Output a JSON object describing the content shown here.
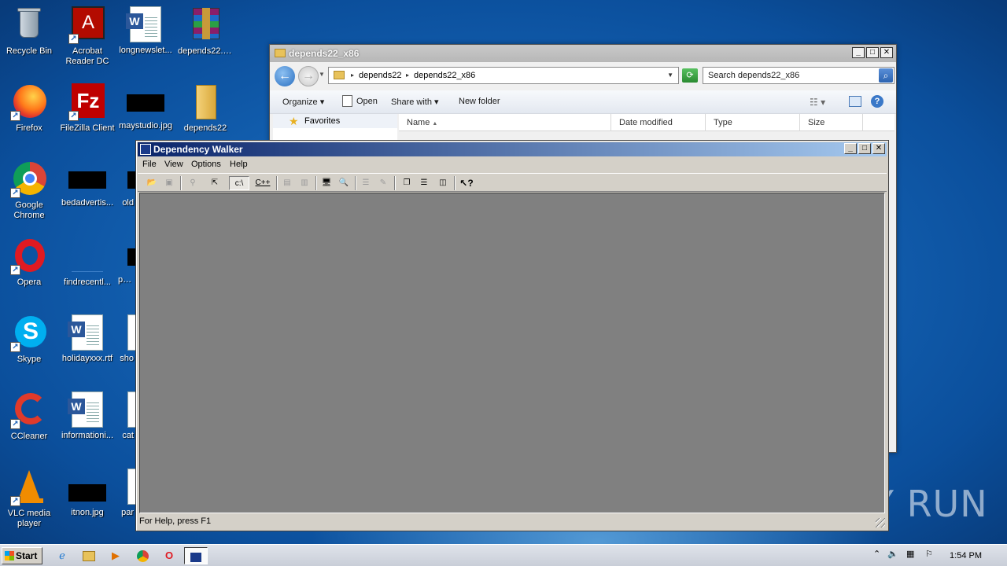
{
  "desktop": {
    "icons": [
      {
        "label": "Recycle Bin",
        "kind": "recycle"
      },
      {
        "label": "Acrobat Reader DC",
        "kind": "acrobat"
      },
      {
        "label": "longnewslet...",
        "kind": "word"
      },
      {
        "label": "depends22.zip",
        "kind": "winrar"
      },
      {
        "label": "Firefox",
        "kind": "firefox"
      },
      {
        "label": "FileZilla Client",
        "kind": "filezilla"
      },
      {
        "label": "maystudio.jpg",
        "kind": "black"
      },
      {
        "label": "depends22",
        "kind": "folder"
      },
      {
        "label": "Google Chrome",
        "kind": "chrome"
      },
      {
        "label": "bedadvertis...",
        "kind": "black"
      },
      {
        "label": "old",
        "kind": "black"
      },
      {
        "label": "Opera",
        "kind": "opera"
      },
      {
        "label": "findrecentl...",
        "kind": "blank"
      },
      {
        "label": "pmb",
        "kind": "black"
      },
      {
        "label": "Skype",
        "kind": "skype"
      },
      {
        "label": "holidayxxx.rtf",
        "kind": "word"
      },
      {
        "label": "sho",
        "kind": "word"
      },
      {
        "label": "CCleaner",
        "kind": "ccleaner"
      },
      {
        "label": "informationi...",
        "kind": "word"
      },
      {
        "label": "cat",
        "kind": "word"
      },
      {
        "label": "VLC media player",
        "kind": "vlc"
      },
      {
        "label": "itnon.jpg",
        "kind": "black"
      },
      {
        "label": "par",
        "kind": "word"
      }
    ]
  },
  "explorer": {
    "title": "depends22_x86",
    "breadcrumb": [
      "depends22",
      "depends22_x86"
    ],
    "search_placeholder": "Search depends22_x86",
    "commands": {
      "organize": "Organize",
      "open": "Open",
      "share_with": "Share with",
      "new_folder": "New folder"
    },
    "nav_favorites": "Favorites",
    "columns": [
      "Name",
      "Date modified",
      "Type",
      "Size"
    ]
  },
  "depwalker": {
    "title": "Dependency Walker",
    "menu": [
      "File",
      "View",
      "Options",
      "Help"
    ],
    "toolbar": {
      "c_drive": "c:\\",
      "cpp": "C++"
    },
    "status": "For Help, press F1"
  },
  "watermark": "ANY RUN",
  "taskbar": {
    "start_label": "Start",
    "clock": "1:54 PM"
  },
  "colors": {
    "desktop_bg": "#1f7ad0",
    "dw_titlebar": "#0a246a",
    "dw_client": "#808080"
  }
}
